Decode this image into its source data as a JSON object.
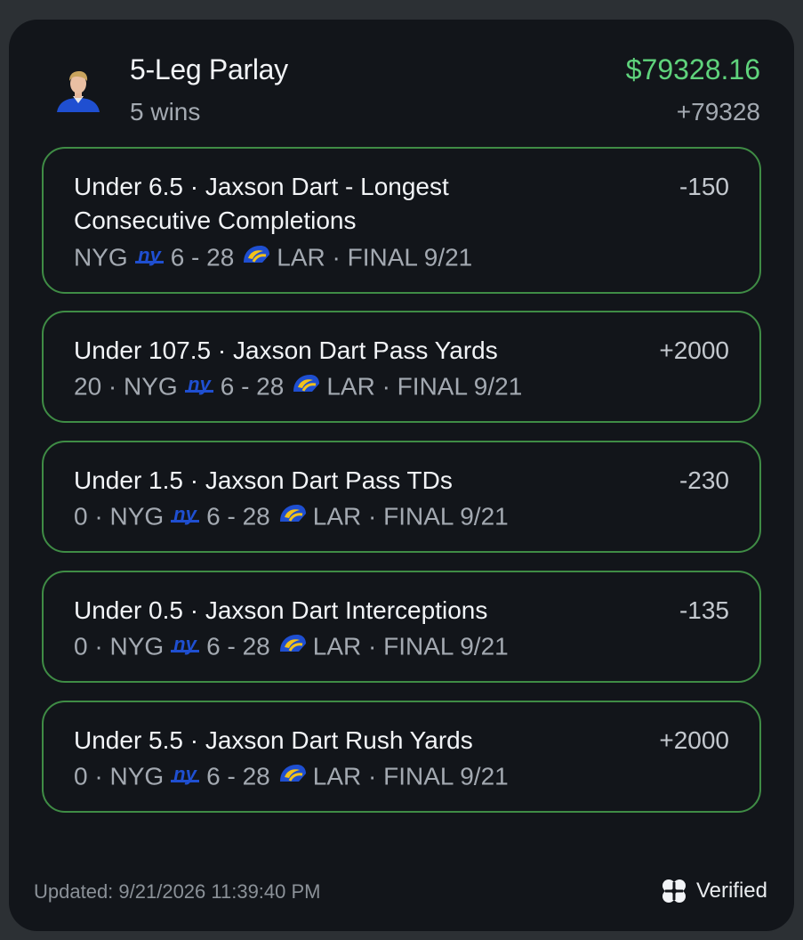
{
  "header": {
    "title": "5-Leg Parlay",
    "subtitle": "5 wins",
    "payout": "$79328.16",
    "odds": "+79328"
  },
  "legs": [
    {
      "title": "Under 6.5 · Jaxson Dart - Longest Consecutive Completions",
      "odds": "-150",
      "prefix": "",
      "team_home": "NYG",
      "score": "6 - 28",
      "team_away": "LAR",
      "status": "· FINAL 9/21"
    },
    {
      "title": "Under 107.5 · Jaxson Dart Pass Yards",
      "odds": "+2000",
      "prefix": "20 ·",
      "team_home": "NYG",
      "score": "6 - 28",
      "team_away": "LAR",
      "status": "· FINAL 9/21"
    },
    {
      "title": "Under 1.5 · Jaxson Dart Pass TDs",
      "odds": "-230",
      "prefix": "0 ·",
      "team_home": "NYG",
      "score": "6 - 28",
      "team_away": "LAR",
      "status": "· FINAL 9/21"
    },
    {
      "title": "Under 0.5 · Jaxson Dart Interceptions",
      "odds": "-135",
      "prefix": "0 ·",
      "team_home": "NYG",
      "score": "6 - 28",
      "team_away": "LAR",
      "status": "· FINAL 9/21"
    },
    {
      "title": "Under 5.5 · Jaxson Dart Rush Yards",
      "odds": "+2000",
      "prefix": "0 ·",
      "team_home": "NYG",
      "score": "6 - 28",
      "team_away": "LAR",
      "status": "· FINAL 9/21"
    }
  ],
  "footer": {
    "updated": "Updated: 9/21/2026 11:39:40 PM",
    "verified": "Verified",
    "verified_icon": "clover-icon"
  },
  "colors": {
    "payout_green": "#5fd37c",
    "leg_border": "#3f8c45",
    "card_bg": "#12151a",
    "nyg_blue": "#1f4fd1",
    "rams_gold": "#f2c21b"
  }
}
